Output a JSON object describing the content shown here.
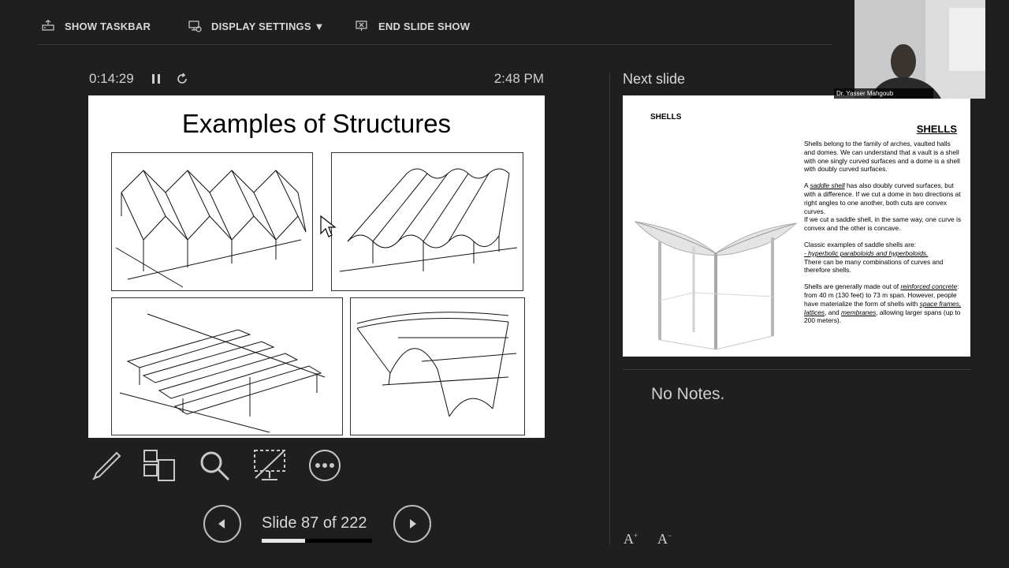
{
  "toolbar": {
    "show_taskbar": "SHOW TASKBAR",
    "display_settings": "DISPLAY SETTINGS ▼",
    "end_slide_show": "END SLIDE SHOW"
  },
  "presenter": {
    "elapsed_time": "0:14:29",
    "clock": "2:48 PM"
  },
  "current_slide": {
    "title": "Examples of Structures"
  },
  "navigation": {
    "slide_counter": "Slide 87 of 222",
    "progress_fraction": 0.392
  },
  "next_slide": {
    "label": "Next slide",
    "small_heading": "SHELLS",
    "heading": "SHELLS",
    "p1": "Shells belong to the family of arches, vaulted halls and domes. We can understand that a vault  is a shell with one singly curved surfaces and a dome is a shell with doubly curved surfaces.",
    "p2_a": "A ",
    "p2_link": "saddle shell",
    "p2_b": " has also doubly curved surfaces, but with a difference.  If we cut a dome in two directions at right angles to one another, both cuts are convex curves.",
    "p2_c": "If we cut a saddle shell, in the same way, one curve is convex and the other is concave.",
    "p3_a": "Classic examples of saddle shells are:",
    "p3_link": "- hyperbolic paraboloids and hyperboloids.",
    "p3_b": "There can be many combinations of curves and therefore shells.",
    "p4_a": "Shells are generally made out of ",
    "p4_link1": "reinforced concrete",
    "p4_b": ": from 40 m (130 feet) to 73 m span. However, people have materialize the form of shells with ",
    "p4_link2": "space frames, lattices",
    "p4_c": ", and ",
    "p4_link3": "membranes",
    "p4_d": ", allowing larger spans (up to 200 meters)."
  },
  "notes": {
    "text": "No Notes."
  },
  "webcam": {
    "name": "Dr. Yasser Mahgoub"
  },
  "icons": [
    "taskbar-icon",
    "display-settings-icon",
    "end-show-icon",
    "pause-icon",
    "restart-icon",
    "pen-icon",
    "see-all-slides-icon",
    "zoom-icon",
    "black-screen-icon",
    "more-options-icon",
    "previous-icon",
    "next-icon",
    "increase-font-icon",
    "decrease-font-icon"
  ],
  "colors": {
    "background": "#1f1f1f",
    "text": "#e6e6e6"
  }
}
